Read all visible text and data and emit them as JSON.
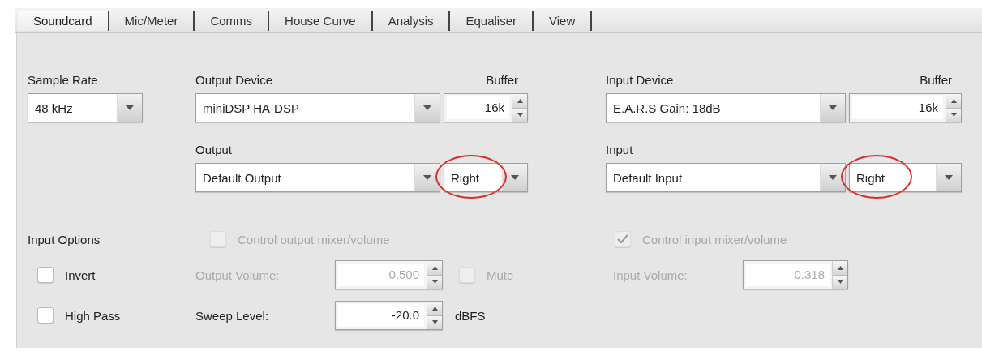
{
  "tabs": [
    {
      "label": "Soundcard",
      "selected": true
    },
    {
      "label": "Mic/Meter",
      "selected": false
    },
    {
      "label": "Comms",
      "selected": false
    },
    {
      "label": "House Curve",
      "selected": false
    },
    {
      "label": "Analysis",
      "selected": false
    },
    {
      "label": "Equaliser",
      "selected": false
    },
    {
      "label": "View",
      "selected": false
    }
  ],
  "sample_rate": {
    "label": "Sample Rate",
    "value": "48 kHz"
  },
  "output": {
    "device_label": "Output Device",
    "device": "miniDSP HA-DSP",
    "buffer_label": "Buffer",
    "buffer": "16k",
    "port_label": "Output",
    "port": "Default Output",
    "channel": "Right",
    "channel_circled": true
  },
  "input": {
    "device_label": "Input Device",
    "device": "E.A.R.S Gain: 18dB",
    "buffer_label": "Buffer",
    "buffer": "16k",
    "port_label": "Input",
    "port": "Default Input",
    "channel": "Right",
    "channel_circled": true
  },
  "input_options": {
    "label": "Input Options",
    "items": [
      {
        "label": "Invert",
        "checked": false
      },
      {
        "label": "High Pass",
        "checked": false
      }
    ]
  },
  "output_control": {
    "label": "Control output mixer/volume",
    "checked": false,
    "disabled": true,
    "volume_label": "Output Volume:",
    "volume": "0.500",
    "mute": {
      "label": "Mute",
      "checked": false,
      "disabled": true
    }
  },
  "input_control": {
    "label": "Control input mixer/volume",
    "checked": true,
    "disabled": true,
    "volume_label": "Input Volume:",
    "volume": "0.318"
  },
  "sweep": {
    "label": "Sweep Level:",
    "value": "-20.0",
    "unit": "dBFS"
  }
}
